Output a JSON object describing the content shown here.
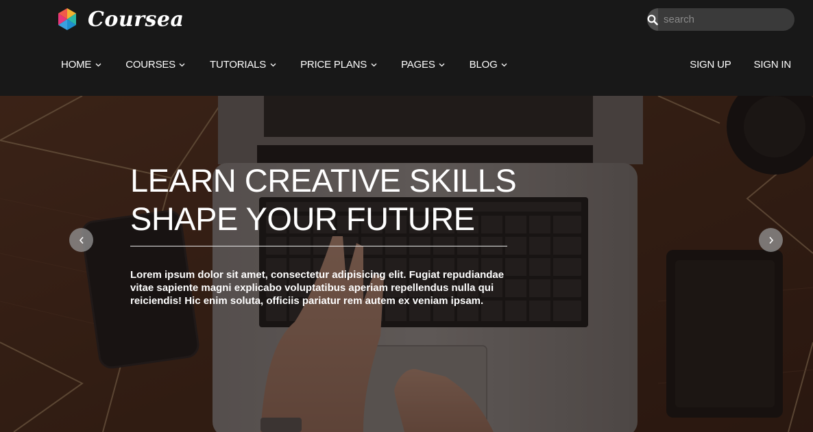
{
  "brand": {
    "name": "Coursea"
  },
  "search": {
    "placeholder": "search"
  },
  "nav": {
    "items": [
      {
        "label": "HOME"
      },
      {
        "label": "COURSES"
      },
      {
        "label": "TUTORIALS"
      },
      {
        "label": "PRICE PLANS"
      },
      {
        "label": "PAGES"
      },
      {
        "label": "BLOG"
      }
    ],
    "signup": "SIGN UP",
    "signin": "SIGN IN"
  },
  "hero": {
    "title_line1": "LEARN CREATIVE SKILLS",
    "title_line2": "SHAPE YOUR FUTURE",
    "text": "Lorem ipsum dolor sit amet, consectetur adipisicing elit. Fugiat repudiandae vitae sapiente magni explicabo voluptatibus aperiam repellendus nulla qui reiciendis! Hic enim soluta, officiis pariatur rem autem ex veniam ipsam."
  },
  "icons": {
    "search": "search-icon",
    "chevron": "chevron-down-icon",
    "prev": "chevron-left-icon",
    "next": "chevron-right-icon",
    "logo": "logo-mark-icon"
  },
  "colors": {
    "header_bg": "#181818",
    "search_bg": "#3a3a3a",
    "text": "#ffffff"
  }
}
